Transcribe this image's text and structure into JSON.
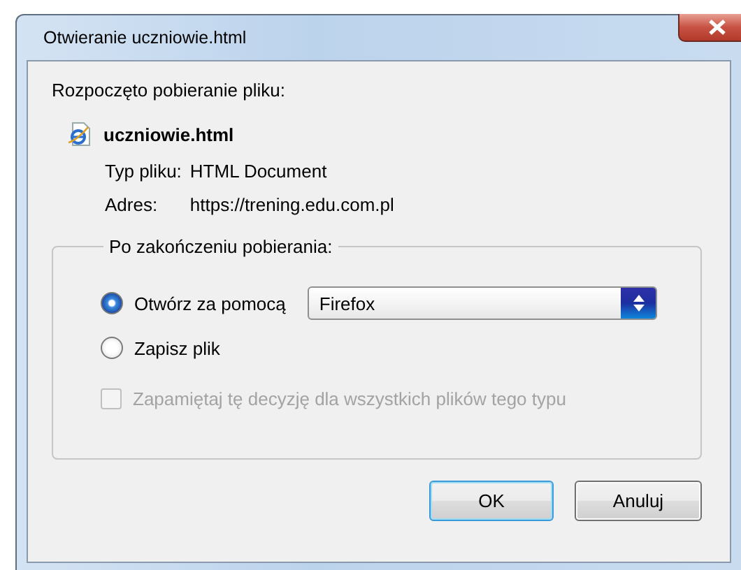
{
  "window": {
    "title": "Otwieranie uczniowie.html"
  },
  "intro": "Rozpoczęto pobieranie pliku:",
  "file": {
    "name": "uczniowie.html",
    "details": [
      {
        "label": "Typ pliku:",
        "value": "HTML Document"
      },
      {
        "label": "Adres:",
        "value": "https://trening.edu.com.pl"
      }
    ]
  },
  "group": {
    "legend": "Po zakończeniu pobierania:",
    "options": [
      {
        "kind": "radio",
        "label": "Otwórz za pomocą",
        "selected": true,
        "select": {
          "value": "Firefox"
        }
      },
      {
        "kind": "radio",
        "label": "Zapisz plik",
        "selected": false
      },
      {
        "kind": "checkbox",
        "label": "Zapamiętaj tę decyzję dla wszystkich plików tego typu",
        "checked": false,
        "disabled": true
      }
    ]
  },
  "buttons": [
    {
      "label": "OK",
      "default": true
    },
    {
      "label": "Anuluj",
      "default": false
    }
  ]
}
